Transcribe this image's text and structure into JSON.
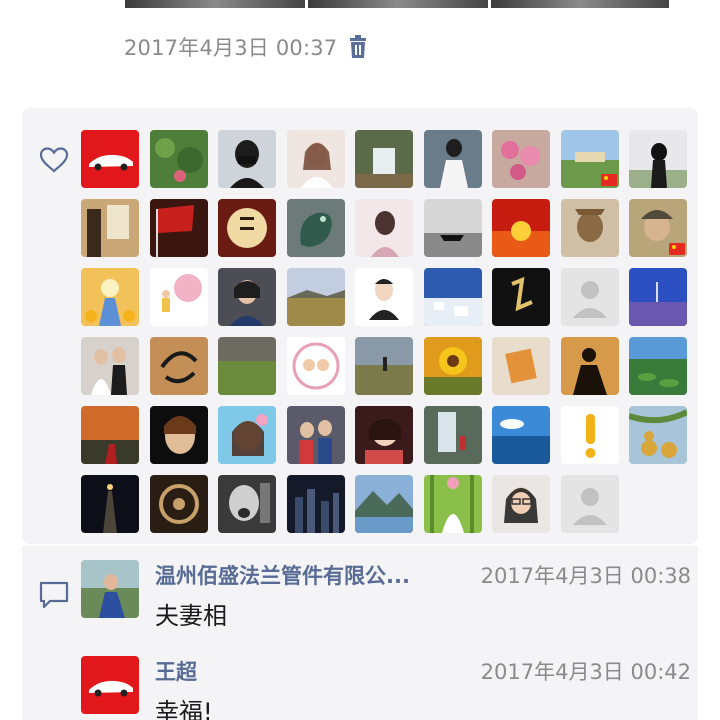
{
  "post": {
    "timestamp": "2017年4月3日 00:37",
    "delete_icon": "trash-icon"
  },
  "likes": {
    "icon": "heart-outline-icon",
    "avatars": [
      {
        "style": "red-car"
      },
      {
        "style": "green-foliage"
      },
      {
        "style": "masked-woman"
      },
      {
        "style": "woman-portrait"
      },
      {
        "style": "waterfall"
      },
      {
        "style": "woman-sitting"
      },
      {
        "style": "pink-flowers"
      },
      {
        "style": "landscape-flag"
      },
      {
        "style": "woman-back"
      },
      {
        "style": "calligraphy-room"
      },
      {
        "style": "red-flag"
      },
      {
        "style": "calligraphy-circle"
      },
      {
        "style": "jade-dragon"
      },
      {
        "style": "sketch-woman"
      },
      {
        "style": "bw-boat"
      },
      {
        "style": "sunset"
      },
      {
        "style": "statue-head"
      },
      {
        "style": "cartoon-man-flag"
      },
      {
        "style": "cartoon-sunflowers"
      },
      {
        "style": "kid-pink-tree"
      },
      {
        "style": "woman-smile"
      },
      {
        "style": "field"
      },
      {
        "style": "man-sketch"
      },
      {
        "style": "santorini"
      },
      {
        "style": "black-calligraphy"
      },
      {
        "style": "default-avatar"
      },
      {
        "style": "lavender-field"
      },
      {
        "style": "wedding"
      },
      {
        "style": "brown-calligraphy"
      },
      {
        "style": "grass-plain"
      },
      {
        "style": "cartoon-family"
      },
      {
        "style": "steppe"
      },
      {
        "style": "sunflower"
      },
      {
        "style": "hands-letter"
      },
      {
        "style": "silhouette"
      },
      {
        "style": "lotus-pond"
      },
      {
        "style": "sunset-woman"
      },
      {
        "style": "cartoon-black"
      },
      {
        "style": "anime-girl"
      },
      {
        "style": "kids-photo"
      },
      {
        "style": "anime-tea"
      },
      {
        "style": "waterfall-man"
      },
      {
        "style": "blue-lake"
      },
      {
        "style": "exclamation"
      },
      {
        "style": "gourds"
      },
      {
        "style": "night-light"
      },
      {
        "style": "bronze-wheel"
      },
      {
        "style": "bw-man"
      },
      {
        "style": "night-city"
      },
      {
        "style": "mountain-lake"
      },
      {
        "style": "bamboo-wedding"
      },
      {
        "style": "woman-glasses"
      },
      {
        "style": "default-avatar"
      }
    ]
  },
  "comments": {
    "icon": "comment-bubble-icon",
    "items": [
      {
        "name": "温州佰盛法兰管件有限公...",
        "time": "2017年4月3日 00:38",
        "text": "夫妻相",
        "avatar": "woman-blue-dress"
      },
      {
        "name": "王超",
        "time": "2017年4月3日 00:42",
        "text": "幸福!",
        "avatar": "red-car"
      }
    ]
  },
  "colors": {
    "link_blue": "#576b95",
    "meta_gray": "#8a8a8a",
    "panel_bg": "#f4f4f6"
  }
}
